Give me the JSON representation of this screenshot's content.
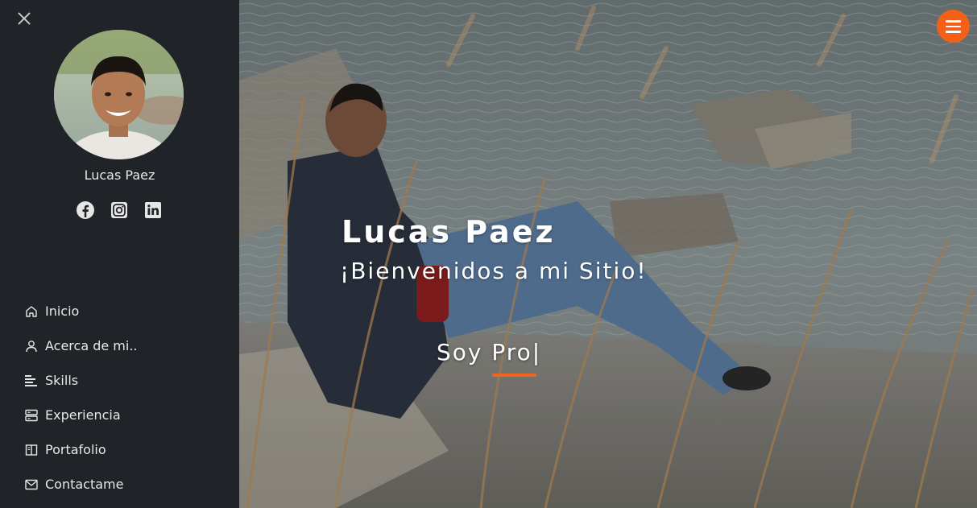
{
  "sidebar": {
    "profile_name": "Lucas Paez",
    "social": [
      {
        "name": "Facebook",
        "icon": "facebook-icon"
      },
      {
        "name": "Instagram",
        "icon": "instagram-icon"
      },
      {
        "name": "LinkedIn",
        "icon": "linkedin-icon"
      }
    ],
    "nav": [
      {
        "label": "Inicio",
        "icon": "home-icon"
      },
      {
        "label": "Acerca de mi..",
        "icon": "user-icon"
      },
      {
        "label": "Skills",
        "icon": "bars-icon"
      },
      {
        "label": "Experiencia",
        "icon": "server-icon"
      },
      {
        "label": "Portafolio",
        "icon": "book-icon"
      },
      {
        "label": "Contactame",
        "icon": "envelope-icon"
      }
    ]
  },
  "hero": {
    "title": "Lucas Paez",
    "welcome": "¡Bienvenidos a mi Sitio!",
    "typed_text": "Soy Pro",
    "typed_cursor": "|"
  },
  "colors": {
    "sidebar_bg": "#202327",
    "accent": "#f55f16",
    "text": "#e8e8e8"
  }
}
